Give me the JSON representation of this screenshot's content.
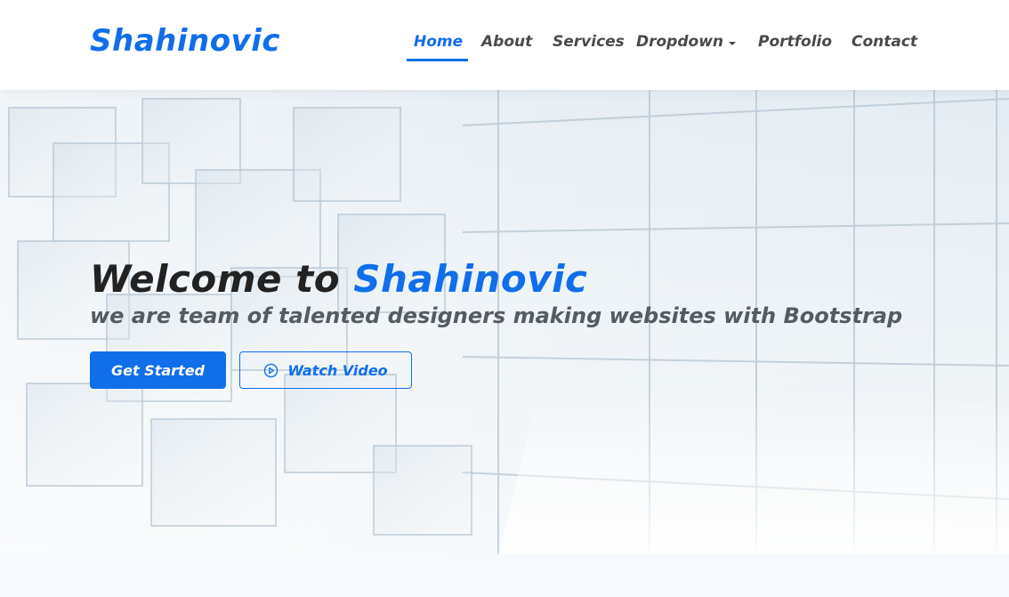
{
  "header": {
    "brand": "Shahinovic",
    "nav": [
      {
        "label": "Home",
        "active": true
      },
      {
        "label": "About",
        "active": false
      },
      {
        "label": "Services",
        "active": false
      },
      {
        "label": "Dropdown",
        "active": false,
        "has_caret": true
      },
      {
        "label": "Portfolio",
        "active": false
      },
      {
        "label": "Contact",
        "active": false
      }
    ]
  },
  "hero": {
    "title_prefix": "Welcome to ",
    "title_accent": "Shahinovic",
    "subtitle": "we are team of talented designers making websites with Bootstrap",
    "primary_button": "Get Started",
    "secondary_button": "Watch Video",
    "secondary_icon": "play-circle-icon"
  },
  "colors": {
    "accent": "#106eea",
    "nav_text": "#4a4a4a",
    "title_text": "#222222",
    "subtitle_text": "#555b63"
  }
}
